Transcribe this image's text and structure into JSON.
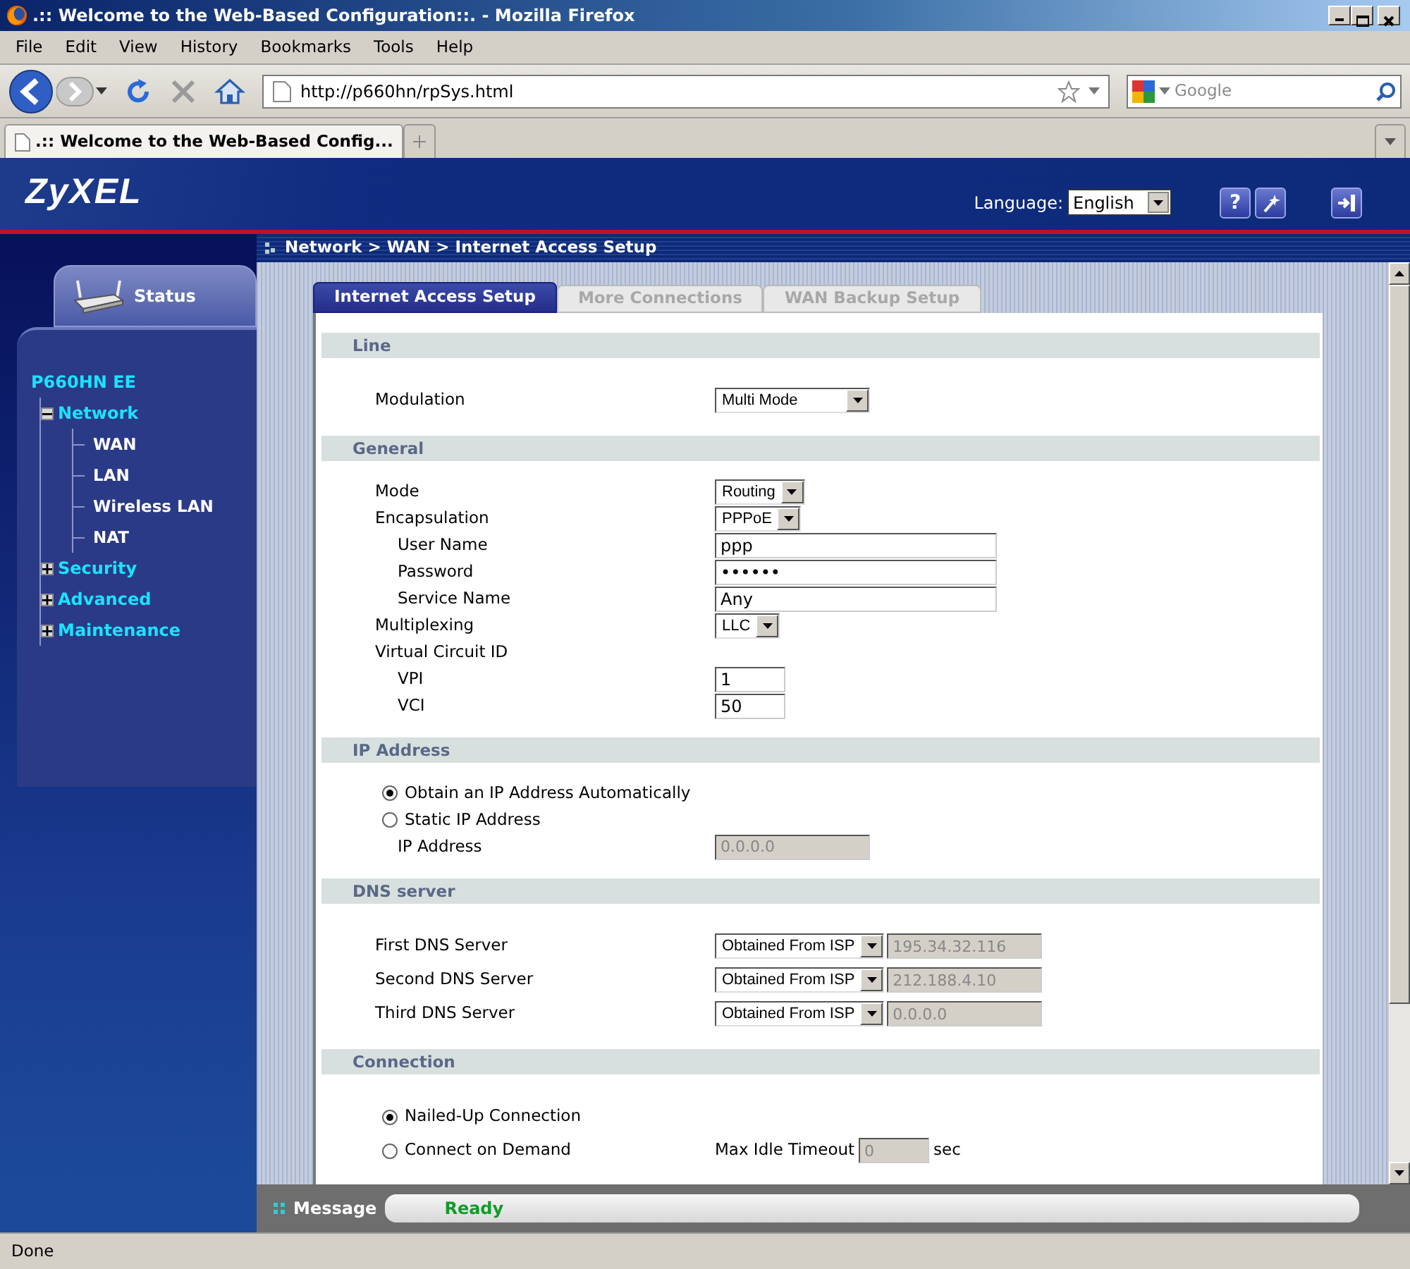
{
  "window": {
    "title": ".:: Welcome to the Web-Based Configuration::. - Mozilla Firefox"
  },
  "menu": [
    "File",
    "Edit",
    "View",
    "History",
    "Bookmarks",
    "Tools",
    "Help"
  ],
  "toolbar": {
    "url": "http://p660hn/rpSys.html",
    "search_placeholder": "Google"
  },
  "browser_tabs": [
    {
      "label": ".:: Welcome to the Web-Based Config...",
      "selected": true
    }
  ],
  "header": {
    "logo": "ZyXEL",
    "language_label": "Language:",
    "language": "English",
    "help": "?"
  },
  "breadcrumb": "Network > WAN > Internet Access Setup",
  "sidebar": {
    "status_tab": "Status",
    "tree": {
      "label": "P660HN EE",
      "children": [
        {
          "label": "Network",
          "expanded": true,
          "children": [
            {
              "label": "WAN"
            },
            {
              "label": "LAN"
            },
            {
              "label": "Wireless LAN"
            },
            {
              "label": "NAT"
            }
          ]
        },
        {
          "label": "Security",
          "expanded": false
        },
        {
          "label": "Advanced",
          "expanded": false
        },
        {
          "label": "Maintenance",
          "expanded": false
        }
      ]
    }
  },
  "page_tabs": [
    {
      "label": "Internet Access Setup",
      "selected": true
    },
    {
      "label": "More Connections",
      "selected": false
    },
    {
      "label": "WAN Backup Setup",
      "selected": false
    }
  ],
  "sections": [
    {
      "title": "Line",
      "rows": [
        {
          "kind": "select",
          "label": "Modulation",
          "value": "Multi Mode"
        }
      ]
    },
    {
      "title": "General",
      "rows": [
        {
          "kind": "select",
          "label": "Mode",
          "value": "Routing"
        },
        {
          "kind": "select",
          "label": "Encapsulation",
          "value": "PPPoE",
          "children": [
            {
              "kind": "text",
              "label": "User Name",
              "value": "ppp",
              "disabled": false
            },
            {
              "kind": "text",
              "label": "Password",
              "value": "••••••",
              "disabled": false
            },
            {
              "kind": "text",
              "label": "Service Name",
              "value": "Any",
              "disabled": false
            }
          ]
        },
        {
          "kind": "select",
          "label": "Multiplexing",
          "value": "LLC"
        },
        {
          "kind": "group",
          "label": "Virtual Circuit ID",
          "children": [
            {
              "kind": "number",
              "label": "VPI",
              "value": "1",
              "disabled": false
            },
            {
              "kind": "number",
              "label": "VCI",
              "value": "50",
              "disabled": false
            }
          ]
        }
      ]
    },
    {
      "title": "IP Address",
      "rows": [
        {
          "kind": "radio",
          "label": "Obtain an IP Address Automatically",
          "selected": true
        },
        {
          "kind": "radio",
          "label": "Static IP Address",
          "selected": false,
          "children": [
            {
              "kind": "address",
              "label": "IP Address",
              "value": "0.0.0.0",
              "disabled": true
            }
          ]
        }
      ]
    },
    {
      "title": "DNS server",
      "rows": [
        {
          "kind": "dns",
          "label": "First DNS Server",
          "value": "Obtained From ISP",
          "address": "195.34.32.116",
          "disabled": true
        },
        {
          "kind": "dns",
          "label": "Second DNS Server",
          "value": "Obtained From ISP",
          "address": "212.188.4.10",
          "disabled": true
        },
        {
          "kind": "dns",
          "label": "Third DNS Server",
          "value": "Obtained From ISP",
          "address": "0.0.0.0",
          "disabled": true
        }
      ]
    },
    {
      "title": "Connection",
      "rows": [
        {
          "kind": "radio",
          "label": "Nailed-Up Connection",
          "selected": true
        },
        {
          "kind": "radio_timeout",
          "label": "Connect on Demand",
          "selected": false,
          "timeout_label": "Max Idle Timeout",
          "timeout_value": "0",
          "unit": "sec",
          "disabled": true
        }
      ]
    }
  ],
  "message": {
    "label": "Message",
    "text": "Ready"
  },
  "status_bar": "Done"
}
